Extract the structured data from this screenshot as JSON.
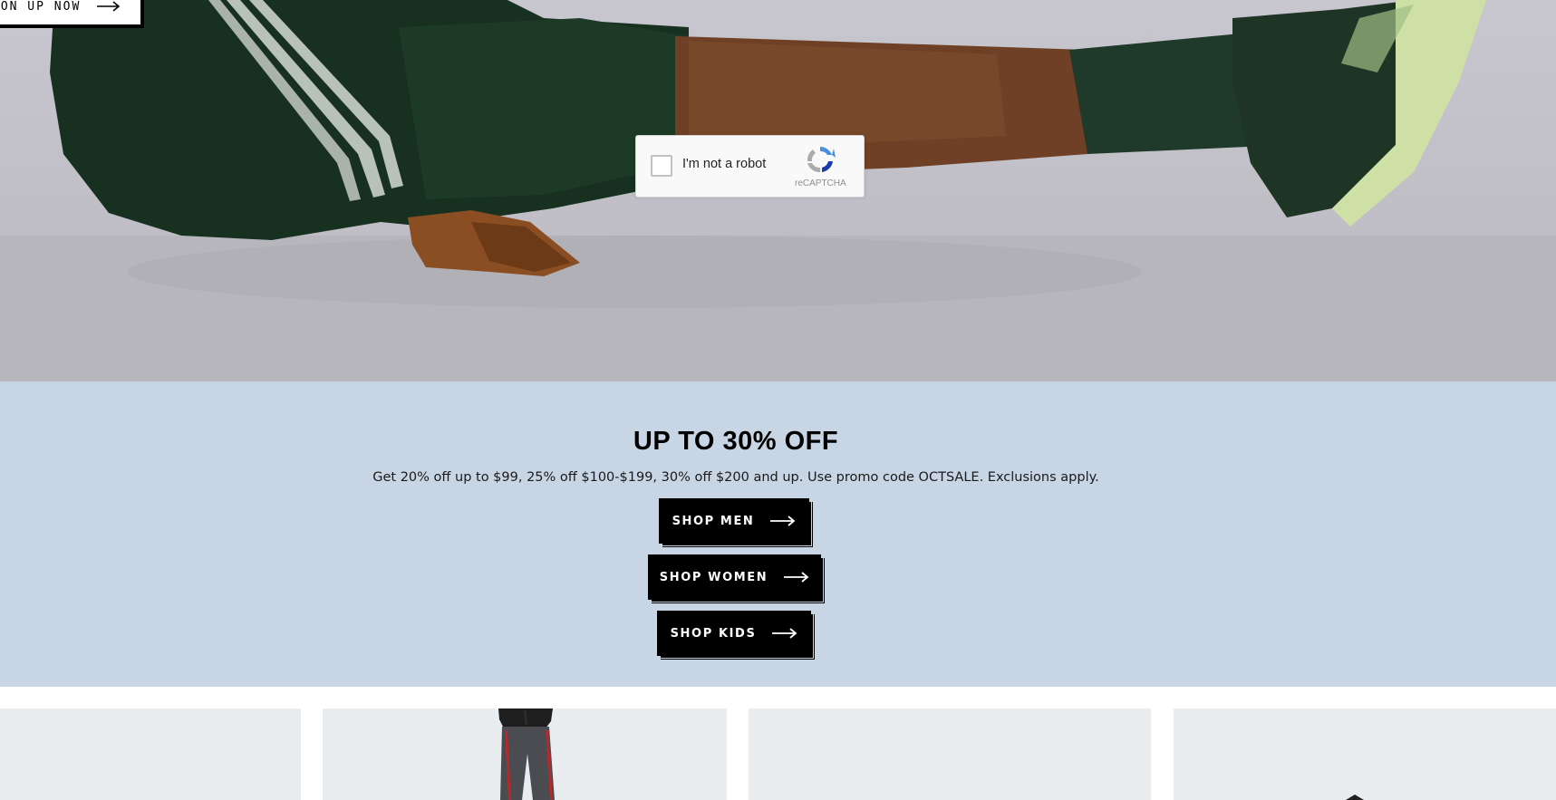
{
  "hero": {
    "cta_label": "ION UP NOW",
    "recaptcha": {
      "label": "I'm not a robot",
      "brand": "reCAPTCHA"
    }
  },
  "promo": {
    "title": "UP TO 30% OFF",
    "description": "Get 20% off up to $99, 25% off $100-$199, 30% off $200 and up. Use promo code OCTSALE. Exclusions apply.",
    "buttons": {
      "men": "SHOP MEN",
      "women": "SHOP WOMEN",
      "kids": "SHOP KIDS"
    },
    "background": "#c8d5e5"
  },
  "products": {
    "card_background": "#eaedf0"
  }
}
